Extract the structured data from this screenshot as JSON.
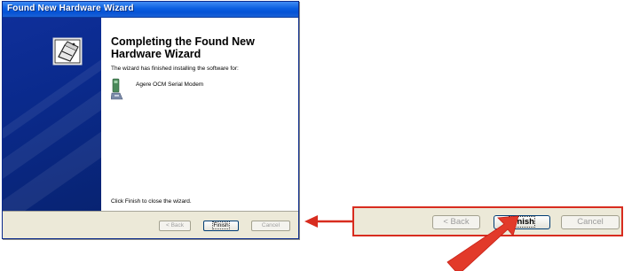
{
  "window": {
    "title": "Found New Hardware Wizard",
    "heading": "Completing the Found New Hardware Wizard",
    "body_text": "The wizard has finished installing the software for:",
    "device_name": "Agere OCM Serial Modem",
    "footer_text": "Click Finish to close the wizard.",
    "buttons": {
      "back": "< Back",
      "finish": "Finish",
      "cancel": "Cancel"
    }
  },
  "zoom": {
    "buttons": {
      "back": "< Back",
      "finish": "Finish",
      "cancel": "Cancel"
    }
  },
  "colors": {
    "titlebar": "#0a5ee0",
    "panel": "#0a2a8c",
    "button_face": "#ece9d8",
    "highlight_red": "#d82c1f"
  },
  "icons": [
    "wizard-hardware-icon",
    "modem-icon",
    "pointer-arrow",
    "connector-arrow"
  ]
}
